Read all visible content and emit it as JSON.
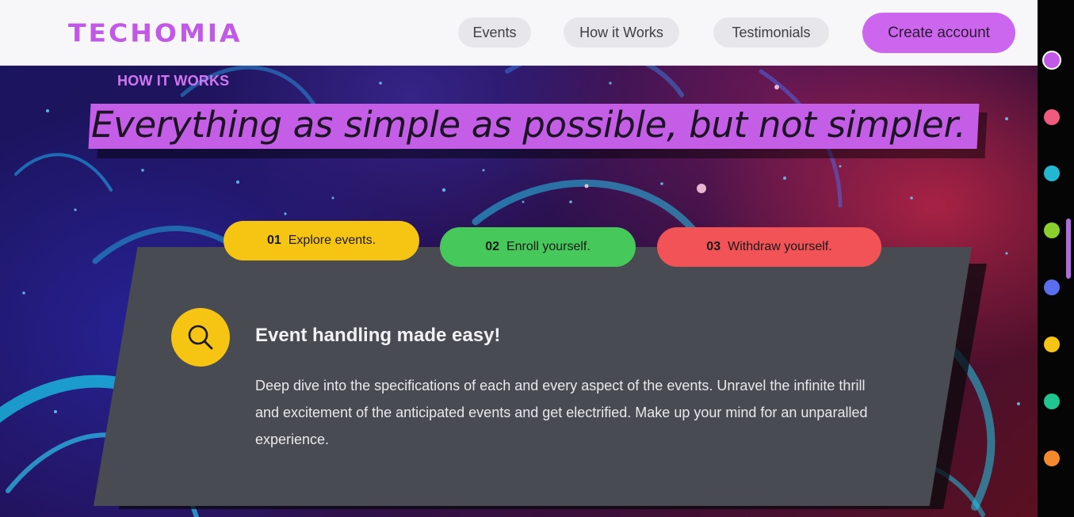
{
  "brand": {
    "name": "TECHOMIA",
    "accent": "#c159e6"
  },
  "nav": {
    "items": [
      {
        "label": "Events"
      },
      {
        "label": "How it Works"
      },
      {
        "label": "Testimonials"
      }
    ],
    "cta_label": "Create account"
  },
  "hero": {
    "eyebrow": "HOW IT WORKS",
    "headline": "Everything as simple as possible, but not simpler."
  },
  "steps": [
    {
      "number": "01",
      "label": "Explore events.",
      "color": "#f6c413"
    },
    {
      "number": "02",
      "label": "Enroll yourself.",
      "color": "#46c95a"
    },
    {
      "number": "03",
      "label": "Withdraw yourself.",
      "color": "#f15356"
    }
  ],
  "feature": {
    "icon": "search-icon",
    "title": "Event handling made easy!",
    "body": "Deep dive into the specifications of each and every aspect of the events. Unravel the infinite thrill and excitement of the anticipated events and get electrified. Make up your mind for an unparalled experience."
  },
  "theme_dots": [
    {
      "color": "#c159e6",
      "active": true
    },
    {
      "color": "#f05a7e",
      "active": false
    },
    {
      "color": "#22b8d1",
      "active": false
    },
    {
      "color": "#8ad12e",
      "active": false
    },
    {
      "color": "#5a6ff0",
      "active": false
    },
    {
      "color": "#f6c413",
      "active": false
    },
    {
      "color": "#1fc48e",
      "active": false
    },
    {
      "color": "#f58a2c",
      "active": false
    }
  ]
}
